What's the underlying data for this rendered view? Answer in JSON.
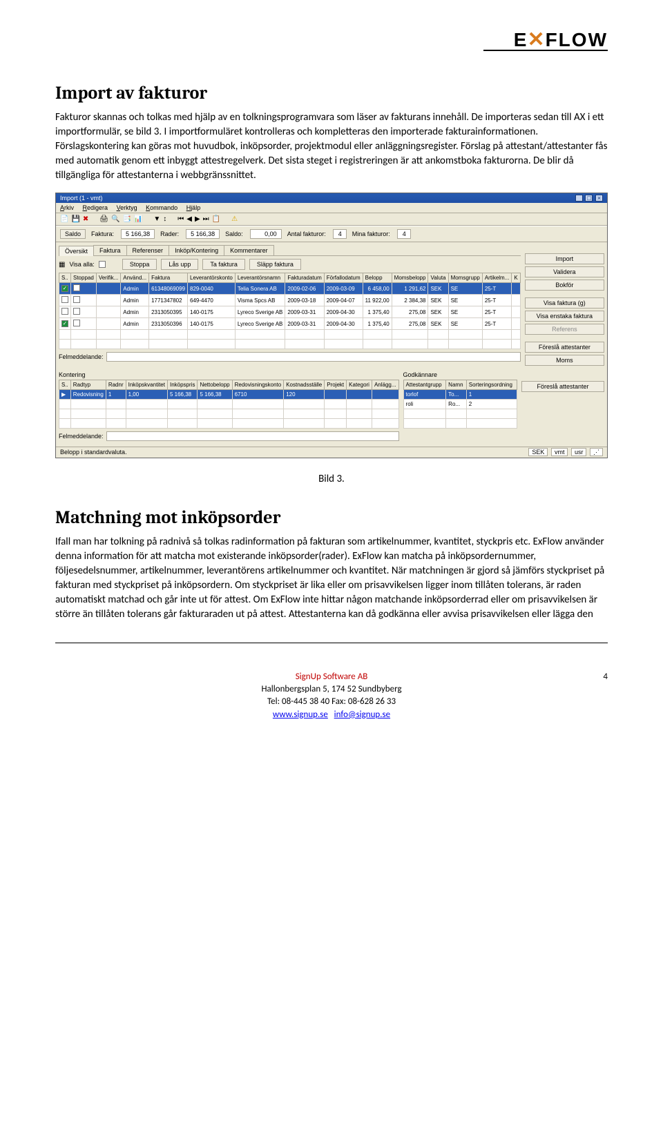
{
  "logo": {
    "pre": "E",
    "x": "✕",
    "post": "FLOW"
  },
  "h1": "Import av fakturor",
  "p1": "Fakturor skannas och tolkas med hjälp av en tolkningsprogramvara som läser av fakturans innehåll. De importeras sedan till AX i ett importformulär, se bild 3. I importformuläret kontrolleras och kompletteras den importerade fakturainformationen. Förslagskontering kan göras mot huvudbok, inköpsorder, projektmodul eller anläggningsregister. Förslag på attestant/attestanter fås med automatik genom ett inbyggt attestregelverk. Det sista steget i registreringen är att ankomstboka fakturorna. De blir då tillgängliga för attestanterna i webbgränssnittet.",
  "caption": "Bild 3.",
  "h2": "Matchning mot inköpsorder",
  "p2": "Ifall man har tolkning på radnivå så tolkas radinformation på fakturan som artikelnummer, kvantitet, styckpris etc. ExFlow använder denna information för att matcha mot existerande inköpsorder(rader). ExFlow kan matcha på inköpsordernummer, följesedelsnummer, artikelnummer, leverantörens artikelnummer och kvantitet. När matchningen är gjord så jämförs styckpriset på fakturan med styckpriset på inköpsordern. Om styckpriset är lika eller om prisavvikelsen ligger inom tillåten tolerans, är raden automatiskt matchad och går inte ut för attest. Om ExFlow inte hittar någon matchande inköpsorderrad eller om prisavvikelsen är större än tillåten tolerans går fakturaraden ut på attest. Attestanterna kan då godkänna eller avvisa prisavvikelsen eller lägga den",
  "footer": {
    "company": "SignUp Software AB",
    "addr": "Hallonbergsplan 5, 174 52 Sundbyberg",
    "tel": "Tel: 08-445 38 40  Fax: 08-628 26 33",
    "web": "www.signup.se",
    "email": "info@signup.se",
    "page": "4"
  },
  "app": {
    "title": "Import (1 - vmt)",
    "menu": [
      "Arkiv",
      "Redigera",
      "Verktyg",
      "Kommando",
      "Hjälp"
    ],
    "saldo": {
      "btn": "Saldo",
      "faktura_l": "Faktura:",
      "faktura_v": "5 166,38",
      "rader_l": "Rader:",
      "rader_v": "5 166,38",
      "saldo_l": "Saldo:",
      "saldo_v": "0,00",
      "antal_l": "Antal fakturor:",
      "antal_v": "4",
      "mina_l": "Mina fakturor:",
      "mina_v": "4"
    },
    "tabs": [
      "Översikt",
      "Faktura",
      "Referenser",
      "Inköp/Kontering",
      "Kommentarer"
    ],
    "filter": {
      "visa": "Visa alla:",
      "btns": [
        "Stoppa",
        "Lås upp",
        "Ta faktura",
        "Släpp faktura"
      ]
    },
    "right": [
      "Import",
      "Validera",
      "Bokför",
      "Visa faktura (g)",
      "Visa enstaka faktura",
      "Referens",
      "Föreslå attestanter",
      "Moms"
    ],
    "gridA": {
      "headers": [
        "S..",
        "Stoppad",
        "Verifik...",
        "Använd...",
        "Faktura",
        "Leverantörskonto",
        "Leverantörsnamn",
        "Fakturadatum",
        "Förfallodatum",
        "Belopp",
        "Momsbelopp",
        "Valuta",
        "Momsgrupp",
        "Artikelm...",
        "K"
      ],
      "rows": [
        {
          "sel": true,
          "chk": true,
          "stop": false,
          "anv": "Admin",
          "fakt": "61348069099",
          "lev": "829-0040",
          "namn": "Telia Sonera AB",
          "fd": "2009-02-06",
          "ffd": "2009-03-09",
          "bel": "6 458,00",
          "moms": "1 291,62",
          "val": "SEK",
          "mg": "SE",
          "am": "25-T"
        },
        {
          "sel": false,
          "chk": false,
          "stop": false,
          "anv": "Admin",
          "fakt": "1771347802",
          "lev": "649-4470",
          "namn": "Visma Spcs AB",
          "fd": "2009-03-18",
          "ffd": "2009-04-07",
          "bel": "11 922,00",
          "moms": "2 384,38",
          "val": "SEK",
          "mg": "SE",
          "am": "25-T"
        },
        {
          "sel": false,
          "chk": false,
          "stop": false,
          "anv": "Admin",
          "fakt": "2313050395",
          "lev": "140-0175",
          "namn": "Lyreco Sverige AB",
          "fd": "2009-03-31",
          "ffd": "2009-04-30",
          "bel": "1 375,40",
          "moms": "275,08",
          "val": "SEK",
          "mg": "SE",
          "am": "25-T"
        },
        {
          "sel": false,
          "chk": true,
          "stop": false,
          "anv": "Admin",
          "fakt": "2313050396",
          "lev": "140-0175",
          "namn": "Lyreco Sverige AB",
          "fd": "2009-03-31",
          "ffd": "2009-04-30",
          "bel": "1 375,40",
          "moms": "275,08",
          "val": "SEK",
          "mg": "SE",
          "am": "25-T"
        }
      ]
    },
    "felmedd_l": "Felmeddelande:",
    "kontering_l": "Kontering",
    "godkannare_l": "Godkännare",
    "right2": "Föreslå attestanter",
    "gridB": {
      "headers": [
        "S..",
        "Radtyp",
        "Radnr",
        "Inköpskvantitet",
        "Inköpspris",
        "Nettobelopp",
        "Redovisningskonto",
        "Kostnadsställe",
        "Projekt",
        "Kategori",
        "Anlägg..."
      ],
      "row": {
        "radtyp": "Redovisning",
        "radnr": "1",
        "kv": "1,00",
        "pr": "5 166,38",
        "nb": "5 166,38",
        "rk": "6710",
        "ks": "120"
      }
    },
    "gridC": {
      "headers": [
        "Attestantgrupp",
        "Namn",
        "Sorteringsordning"
      ],
      "rows": [
        {
          "a": "torlof",
          "b": "To...",
          "c": "1"
        },
        {
          "a": "roli",
          "b": "Ro...",
          "c": "2"
        }
      ]
    },
    "felmedd2_l": "Felmeddelande:",
    "status_l": "Belopp i standardvaluta.",
    "status_r": [
      "SEK",
      "vmt",
      "usr"
    ]
  }
}
